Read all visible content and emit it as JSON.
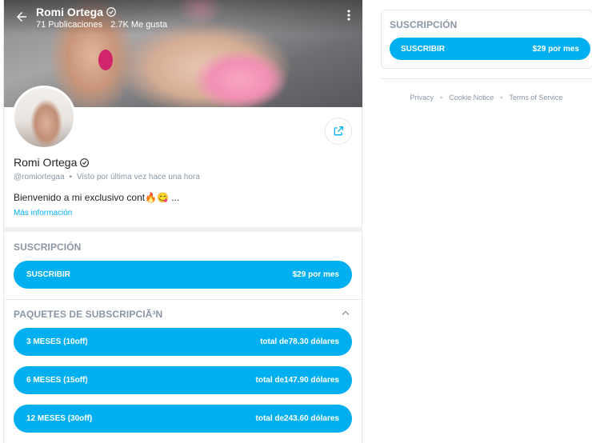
{
  "colors": {
    "accent": "#00aff0",
    "muted": "#8a96a3",
    "text": "#242529",
    "border": "#e6e7e8"
  },
  "header": {
    "name": "Romi Ortega",
    "posts": "71 Publicaciones",
    "likes": "2.7K Me gusta",
    "back_icon": "arrow-left-icon",
    "menu_icon": "more-vertical-icon"
  },
  "profile": {
    "name": "Romi Ortega",
    "verified_icon": "verified-check-icon",
    "username": "@romiortegaa",
    "last_seen": "Visto por última vez hace una hora",
    "bio": "Bienvenido a mi exclusivo cont🔥😋 ...",
    "more_info": "Más información",
    "share_icon": "share-icon"
  },
  "subscription": {
    "title": "SUSCRIPCIÓN",
    "button_label": "SUSCRIBIR",
    "price": "$29 por mes"
  },
  "bundles": {
    "title": "PAQUETES DE SUBSCRIPCIÃ³N",
    "collapse_icon": "chevron-up-icon",
    "items": [
      {
        "label": "3 MESES (10off)",
        "price": "total de78.30 dólares"
      },
      {
        "label": "6 MESES (15off)",
        "price": "total de147.90 dólares"
      },
      {
        "label": "12 MESES (30off)",
        "price": "total de243.60 dólares"
      }
    ]
  },
  "sidebar": {
    "subscription": {
      "title": "SUSCRIPCIÓN",
      "button_label": "SUSCRIBIR",
      "price": "$29 por mes"
    },
    "footer": {
      "privacy": "Privacy",
      "cookie": "Cookie Notice",
      "terms": "Terms of Service"
    }
  }
}
